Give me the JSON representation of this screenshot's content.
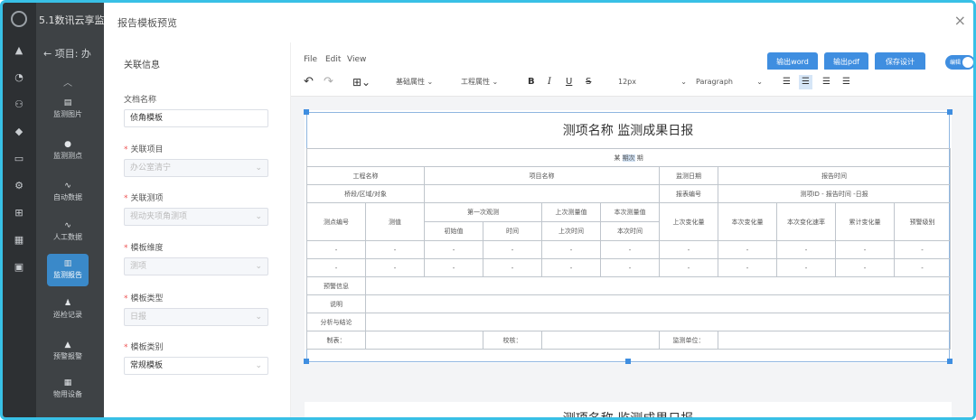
{
  "app": {
    "title": "5.1数讯云享监"
  },
  "nav": {
    "project_label": "项目: 办",
    "items": [
      {
        "label": "监测图片"
      },
      {
        "label": "监测测点"
      },
      {
        "label": "自动数据"
      },
      {
        "label": "人工数据"
      },
      {
        "label": "监测报告"
      },
      {
        "label": "巡检记录"
      },
      {
        "label": "预警报警"
      },
      {
        "label": "物用设备"
      }
    ]
  },
  "modal": {
    "title": "报告模板预览",
    "close": "×"
  },
  "form": {
    "section_title": "关联信息",
    "fields": [
      {
        "label": "文档名称",
        "value": "侦角模板",
        "required": false
      },
      {
        "label": "关联项目",
        "value": "办公室清宁",
        "required": true
      },
      {
        "label": "关联测项",
        "value": "视动夹项角测项",
        "required": true
      },
      {
        "label": "模板维度",
        "value": "测项",
        "required": true
      },
      {
        "label": "模板类型",
        "value": "日报",
        "required": true
      },
      {
        "label": "模板类别",
        "value": "常规模板",
        "required": true
      }
    ]
  },
  "editor": {
    "menus": [
      "File",
      "Edit",
      "View"
    ],
    "buttons": {
      "export_word": "输出word",
      "export_pdf": "输出pdf",
      "save": "保存设计",
      "toggle": "编辑"
    },
    "toolbar": {
      "basic_props": "基础属性",
      "project_props": "工程属性",
      "font_size": "12px",
      "paragraph": "Paragraph"
    }
  },
  "report": {
    "title": "测项名称 监测成果日报",
    "date_line_a": "某",
    "date_line_b": "期次",
    "date_line_c": "期",
    "row2": {
      "c1": "工程名称",
      "c2": "项目名称",
      "c3": "监测日期",
      "c4": "报告时间"
    },
    "row3": {
      "c1": "桥段/区域/对象",
      "c3": "报表编号",
      "c4": "测项ID - 报告时间 -日报"
    },
    "headers": {
      "point": "测点编号",
      "value": "测值",
      "first": "第一次观测",
      "last": "上次测量值",
      "this": "本次测量值",
      "last_change": "上次变化量",
      "this_change": "本次变化量",
      "rate": "本次变化速率",
      "cum": "累计变化量",
      "warn": "预警级别",
      "init": "初始值",
      "time": "时间",
      "last_time": "上次时间",
      "this_time": "本次时间"
    },
    "dash": "-",
    "footer": {
      "warn_info": "预警信息",
      "note": "说明",
      "analysis": "分析与结论",
      "maker": "制表：",
      "check": "校核：",
      "unit": "监测单位："
    }
  }
}
